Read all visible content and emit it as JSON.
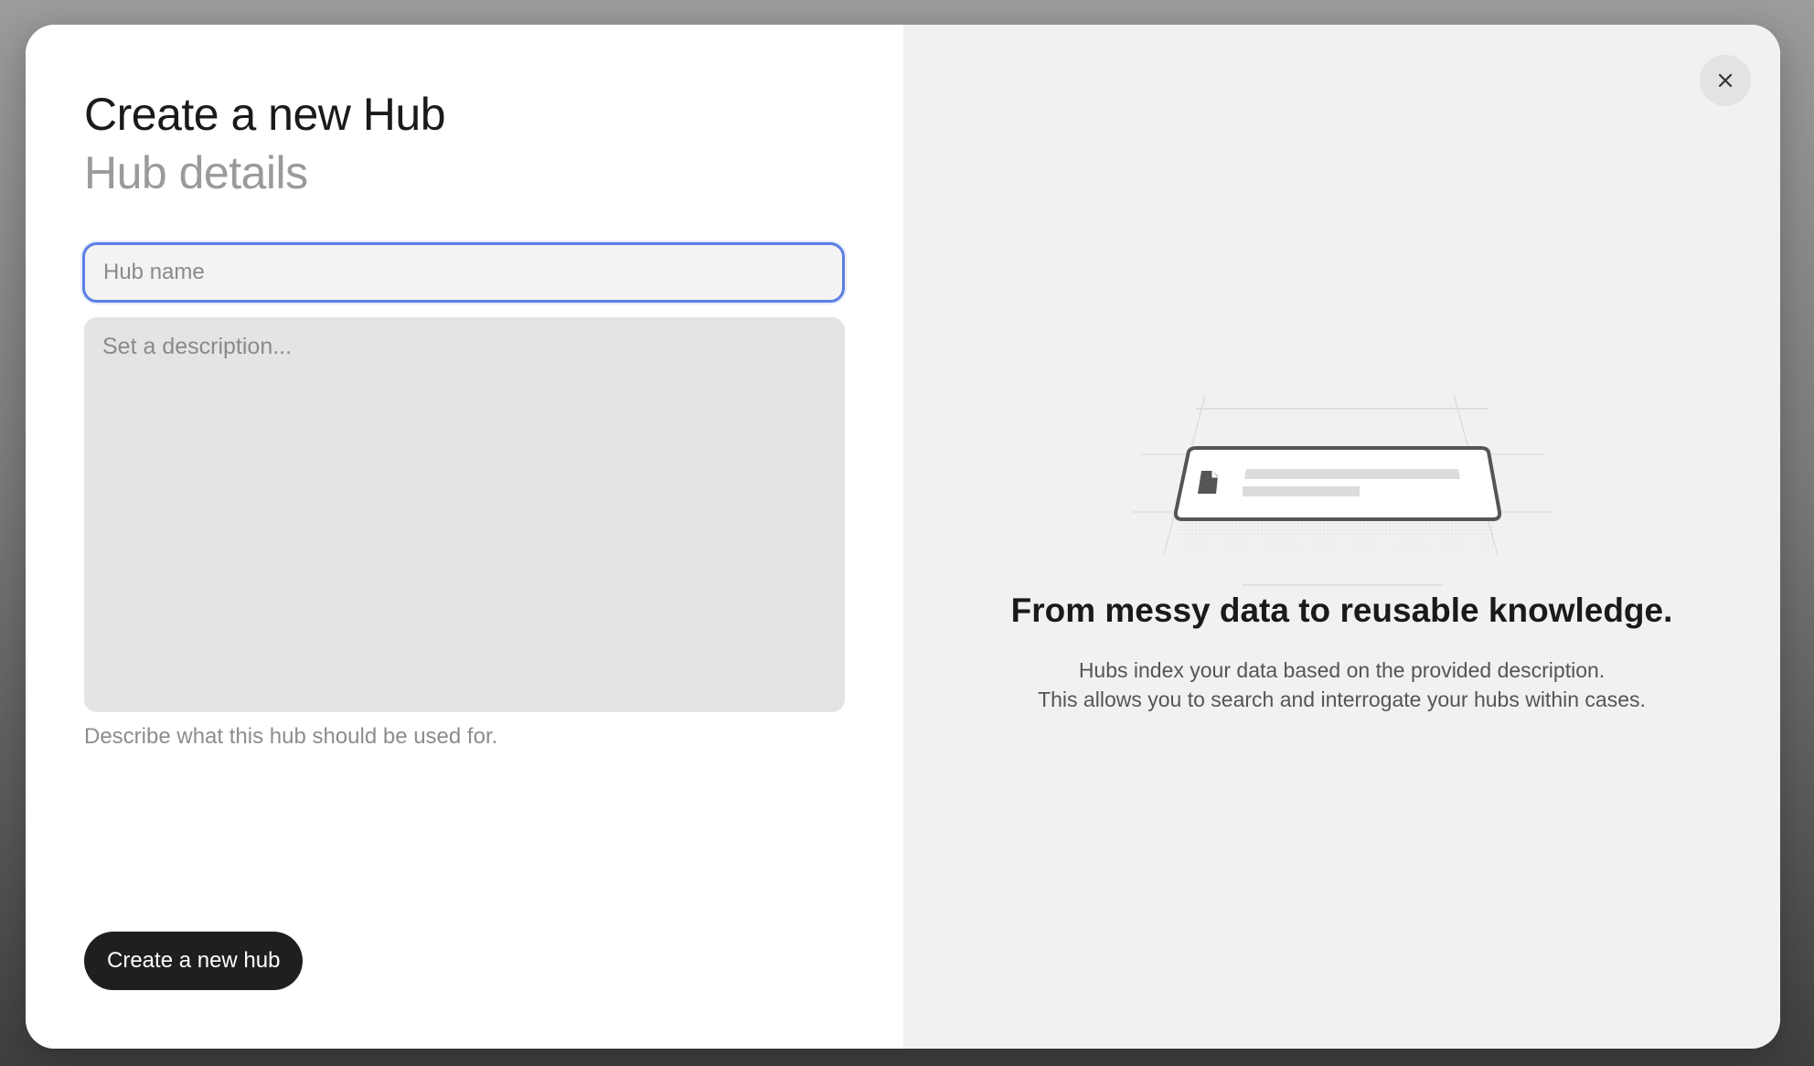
{
  "modal": {
    "title": "Create a new Hub",
    "subtitle": "Hub details"
  },
  "form": {
    "name_placeholder": "Hub name",
    "name_value": "",
    "description_placeholder": "Set a description...",
    "description_value": "",
    "description_hint": "Describe what this hub should be used for.",
    "submit_label": "Create a new hub"
  },
  "info": {
    "headline": "From messy data to reusable knowledge.",
    "line1": "Hubs index your data based on the provided description.",
    "line2": "This allows you to search and interrogate your hubs within cases."
  },
  "icons": {
    "close": "close-icon",
    "document": "document-icon"
  },
  "colors": {
    "focus_border": "#5b7fe3",
    "primary_button": "#1f1f1f",
    "right_panel": "#f1f1f1"
  }
}
